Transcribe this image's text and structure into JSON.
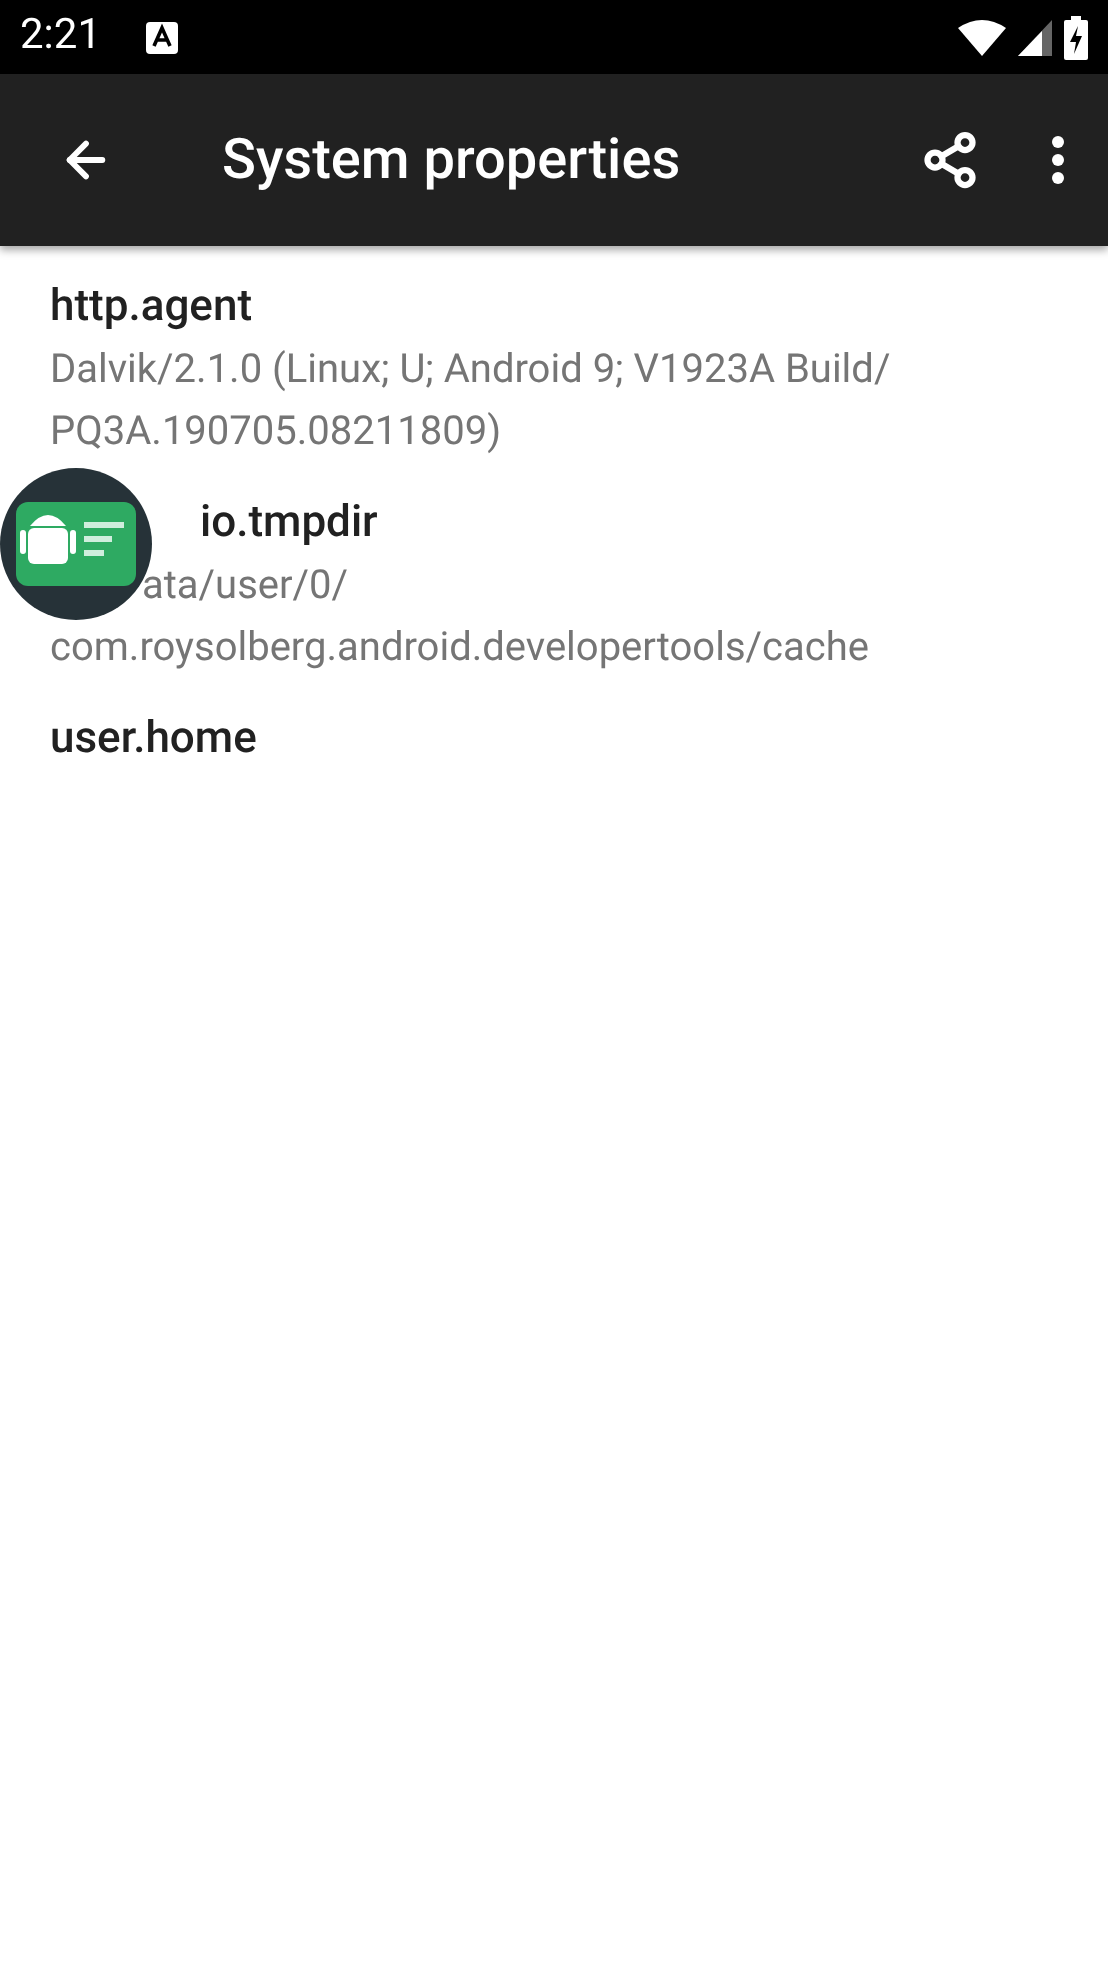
{
  "status_bar": {
    "time": "2:21"
  },
  "toolbar": {
    "title": "System properties"
  },
  "properties": [
    {
      "name": "http.agent",
      "value": "Dalvik/2.1.0 (Linux; U; Android 9; V1923A Build/ PQ3A.190705.08211809)",
      "covered": false
    },
    {
      "name": "io.tmpdir",
      "value": "ata/user/0/ com.roysolberg.android.developertools/cache",
      "covered": true
    },
    {
      "name": "user.home",
      "covered": false
    }
  ]
}
